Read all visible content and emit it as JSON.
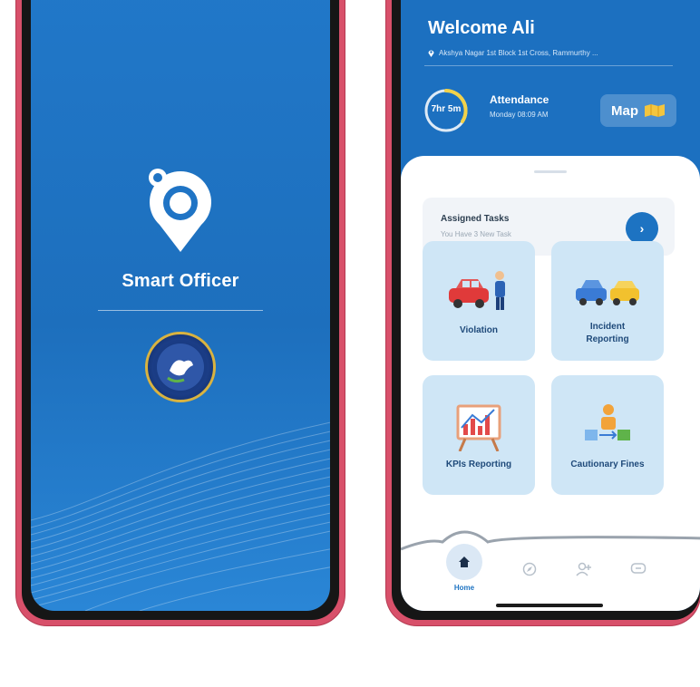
{
  "splash": {
    "app_name": "Smart Officer",
    "logo_icon": "location-pin-logo-icon",
    "emblem_icon": "police-emblem-icon"
  },
  "home": {
    "welcome": "Welcome Ali",
    "address": "Akshya Nagar 1st Block 1st Cross, Rammurthy ...",
    "attendance": {
      "ring_label": "7hr 5m",
      "title": "Attendance",
      "time": "Monday 08:09 AM"
    },
    "map_button": "Map",
    "assigned_tasks": {
      "title": "Assigned Tasks",
      "subtitle": "You Have 3 New Task"
    },
    "tiles": [
      {
        "label": "Violation",
        "icon": "car-officer-icon"
      },
      {
        "label": "Incident Reporting",
        "icon": "car-collision-icon"
      },
      {
        "label": "KPIs Reporting",
        "icon": "chart-board-icon"
      },
      {
        "label": "Cautionary Fines",
        "icon": "fines-transfer-icon"
      }
    ],
    "nav": {
      "home_label": "Home",
      "items": [
        "compass-icon",
        "user-add-icon",
        "chat-icon"
      ]
    }
  },
  "colors": {
    "primary_blue": "#1d73c2",
    "phone_frame": "#d8506a",
    "tile_bg": "#cfe6f6",
    "ring_accent": "#f2d24a"
  }
}
